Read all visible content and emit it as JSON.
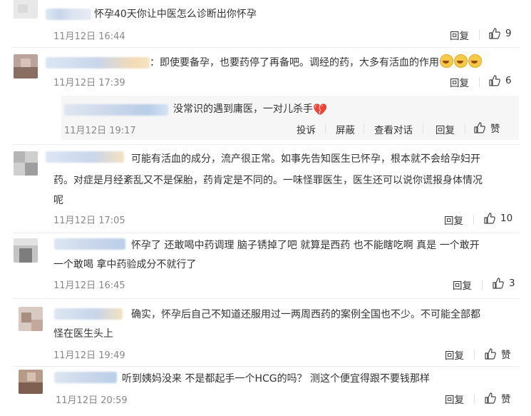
{
  "comments": [
    {
      "text": "怀孕40天你让中医怎么诊断出你怀孕",
      "time": "11月12日 16:44",
      "reply_label": "回复",
      "likes": "9"
    },
    {
      "text": "：即使要备孕，也要药停了再备吧。调经的药，大多有活血的作用",
      "emoji_count": 3,
      "time": "11月12日 17:39",
      "reply_label": "回复",
      "likes": "6",
      "sub_reply": {
        "text": "没常识的遇到庸医，一对儿杀手",
        "icon": "broken-heart-icon",
        "time": "11月12日 19:17",
        "actions": [
          "投诉",
          "屏蔽",
          "查看对话",
          "回复"
        ],
        "like_label": "赞"
      }
    },
    {
      "lines": [
        "可能有活血的成分，流产很正常。如事先告知医生已怀孕，根本就不会给孕妇开",
        "药。对症是月经紊乱又不是保胎，药肯定是不同的。一味怪罪医生，医生还可以说你谎报身体情况",
        "呢"
      ],
      "time": "11月12日 17:05",
      "reply_label": "回复",
      "likes": "10"
    },
    {
      "lines": [
        "怀孕了  还敢喝中药调理 脑子锈掉了吧 就算是西药 也不能瞎吃啊 真是 一个敢开",
        "一个敢喝 拿中药验成分不就行了"
      ],
      "time": "11月12日 16:45",
      "reply_label": "回复",
      "likes": "3"
    },
    {
      "lines": [
        "确实，怀孕后自己不知道还服用过一两周西药的案例全国也不少。不可能全部都",
        "怪在医生头上"
      ],
      "time": "11月12日 19:49",
      "reply_label": "回复",
      "likes": "赞"
    },
    {
      "text": "听到姨妈没来 不是都起手一个HCG的吗？ 测这个便宜得跟不要钱那样",
      "time": "11月12日 20:59",
      "reply_label": "回复",
      "likes": "赞"
    }
  ]
}
